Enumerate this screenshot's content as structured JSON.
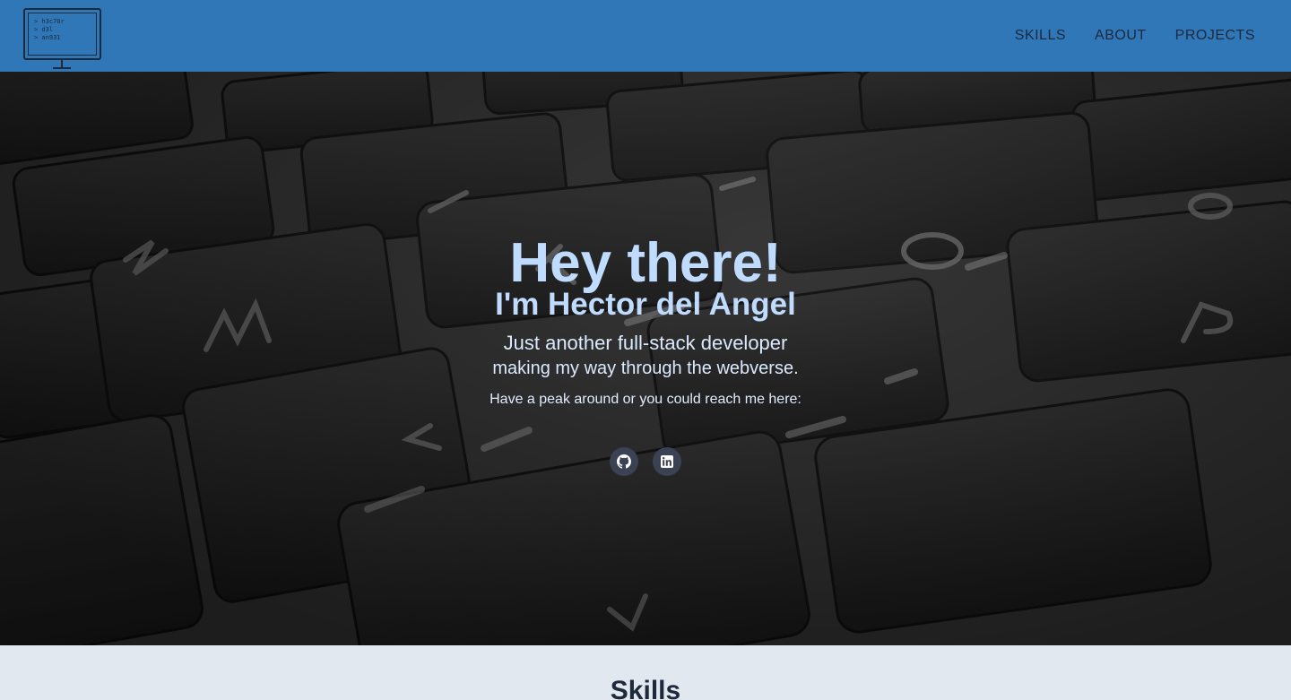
{
  "header": {
    "logo_lines": "> h3c70r\n> d3l\n> an931",
    "nav": [
      {
        "label": "SKILLS"
      },
      {
        "label": "ABOUT"
      },
      {
        "label": "PROJECTS"
      }
    ]
  },
  "hero": {
    "title": "Hey there!",
    "name": "I'm Hector del Angel",
    "sub1": "Just another full-stack developer",
    "sub2": "making my way through the webverse.",
    "sub3": "Have a peak around or you could reach me here:",
    "socials": [
      {
        "icon": "github-icon"
      },
      {
        "icon": "linkedin-icon"
      }
    ]
  },
  "skills": {
    "title": "Skills"
  },
  "colors": {
    "header_bg": "#2f77b7",
    "hero_text": "#bfdbfe",
    "section_bg": "#e2e8f0"
  }
}
